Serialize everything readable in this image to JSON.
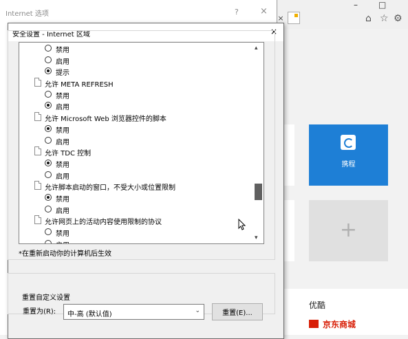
{
  "background": {
    "window_controls": [
      "–",
      "□"
    ],
    "toolbar_icons": [
      "⌂",
      "☆",
      "⚙"
    ],
    "tab_close": "×",
    "tiles": {
      "ctrip": {
        "label": "携程",
        "color": "#1e7fd6"
      },
      "add": {
        "symbol": "+"
      }
    },
    "youku": "优酷",
    "jd": "京东商城"
  },
  "ie_options": {
    "title": "Internet 选项",
    "help": "?",
    "close": "×"
  },
  "dialog": {
    "title": "安全设置 - Internet 区域",
    "close": "×",
    "settings_group": "设置",
    "items": [
      {
        "type": "option",
        "label": "禁用",
        "checked": false
      },
      {
        "type": "option",
        "label": "启用",
        "checked": false
      },
      {
        "type": "option",
        "label": "提示",
        "checked": true
      },
      {
        "type": "header",
        "label": "允许 META REFRESH"
      },
      {
        "type": "option",
        "label": "禁用",
        "checked": false
      },
      {
        "type": "option",
        "label": "启用",
        "checked": true
      },
      {
        "type": "header",
        "label": "允许 Microsoft Web 浏览器控件的脚本"
      },
      {
        "type": "option",
        "label": "禁用",
        "checked": true
      },
      {
        "type": "option",
        "label": "启用",
        "checked": false
      },
      {
        "type": "header",
        "label": "允许 TDC 控制"
      },
      {
        "type": "option",
        "label": "禁用",
        "checked": true
      },
      {
        "type": "option",
        "label": "启用",
        "checked": false
      },
      {
        "type": "header",
        "label": "允许脚本启动的窗口，不受大小或位置限制"
      },
      {
        "type": "option",
        "label": "禁用",
        "checked": true
      },
      {
        "type": "option",
        "label": "启用",
        "checked": false
      },
      {
        "type": "header",
        "label": "允许网页上的活动内容使用限制的协议"
      },
      {
        "type": "option",
        "label": "禁用",
        "checked": false
      },
      {
        "type": "option",
        "label": "启用",
        "checked": false
      }
    ],
    "scroll_up": "▴",
    "scroll_down": "▾",
    "restart_note": "*在重新启动你的计算机后生效",
    "reset_group": "重置自定义设置",
    "reset_to_label": "重置为(R):",
    "reset_select_value": "中-高 (默认值)",
    "reset_select_chevron": "⌄",
    "reset_button": "重置(E)..."
  }
}
